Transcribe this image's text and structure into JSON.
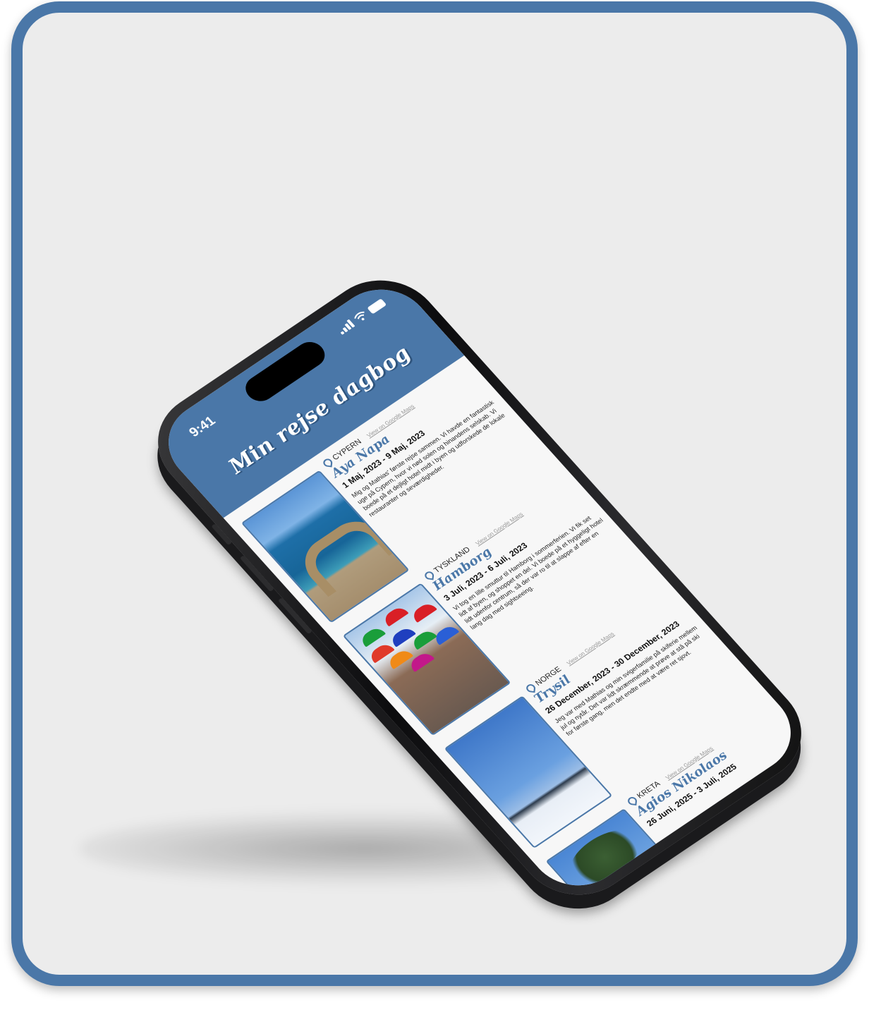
{
  "status": {
    "time": "9:41"
  },
  "app": {
    "title": "Min rejse dagbog"
  },
  "entries": [
    {
      "country": "CYPERN",
      "maps_link": "View on Google Maps",
      "place": "Aya Napa",
      "dates": "1 Maj, 2023 - 9 Maj, 2023",
      "description": "Mig og Mathias' første rejse sammen. Vi havde en fantastisk uge på Cypern, hvor vi nød solen og hinandens selskab. Vi boede på et dejligt hotel midt i byen og udforskede de lokale restauranter og seværdigheder."
    },
    {
      "country": "TYSKLAND",
      "maps_link": "View on Google Maps",
      "place": "Hamborg",
      "dates": "3 Juli, 2023 - 6 Juli, 2023",
      "description": "Vi tog en lille smuttur til Hamborg i sommerferien. Vi fik set lidt af byen, og shoppet en del. Vi boede på et hyggeligt hotel lidt udenfor centrum, så der var ro til at slappe af efter en lang dag med sightseeing."
    },
    {
      "country": "NORGE",
      "maps_link": "View on Google Maps",
      "place": "Trysil",
      "dates": "26 December, 2023 - 30 December, 2023",
      "description": "Jeg var med Mathias og min svigerfamilie på skiferie mellem jul og nytår. Det var lidt skræmmende at prøve at stå på ski for første gang, men det endte med at være ret sjovt."
    },
    {
      "country": "KRETA",
      "maps_link": "View on Google Maps",
      "place": "Agios Nikolaos",
      "dates": "26 Juni, 2025 - 3 Juli, 2025",
      "description": ""
    }
  ],
  "colors": {
    "brand": "#4a77a8",
    "frame": "#4a77a8",
    "background": "#ececec"
  },
  "icons": [
    "location-pin-icon",
    "signal-icon",
    "wifi-icon",
    "battery-icon"
  ]
}
